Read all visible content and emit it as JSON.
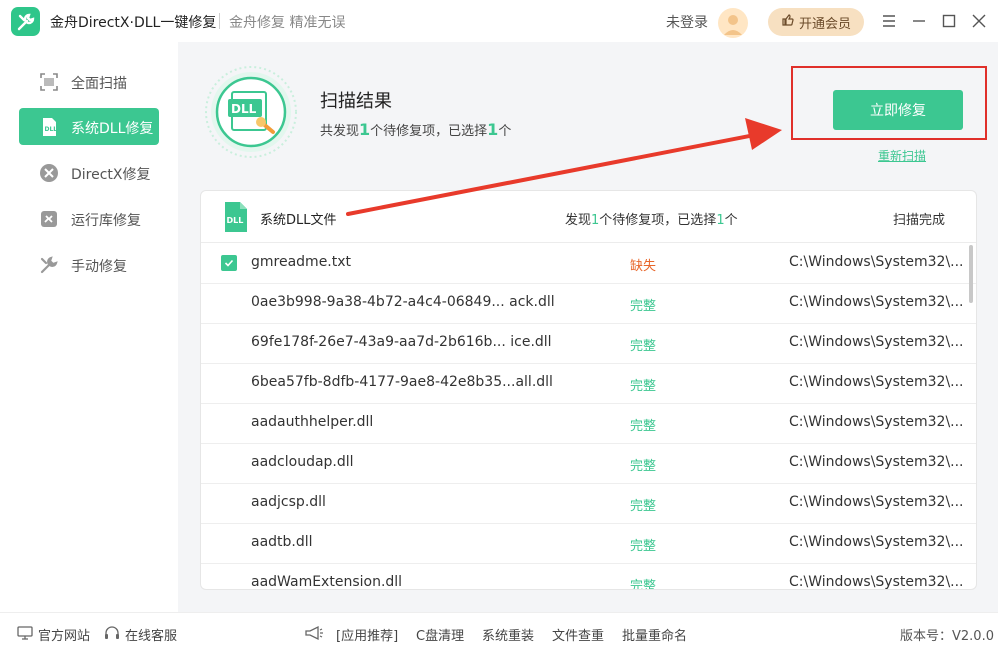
{
  "app": {
    "title": "金舟DirectX·DLL一键修复",
    "slogan": "金舟修复 精准无误",
    "login": "未登录",
    "vip_button": "开通会员"
  },
  "sidebar": {
    "items": [
      {
        "label": "全面扫描",
        "icon": "scan-icon",
        "active": false
      },
      {
        "label": "系统DLL修复",
        "icon": "dll-icon",
        "active": true
      },
      {
        "label": "DirectX修复",
        "icon": "directx-icon",
        "active": false
      },
      {
        "label": "运行库修复",
        "icon": "runtime-icon",
        "active": false
      },
      {
        "label": "手动修复",
        "icon": "wrench-icon",
        "active": false
      }
    ]
  },
  "scan": {
    "title": "扫描结果",
    "sub_prefix": "共发现",
    "found": "1",
    "sub_mid": "个待修复项，已选择",
    "selected": "1",
    "sub_suffix": "个",
    "badge": "DLL"
  },
  "actions": {
    "fix_button": "立即修复",
    "rescan_link": "重新扫描"
  },
  "panel": {
    "icon_text": "DLL",
    "title": "系统DLL文件",
    "count_prefix": "发现",
    "count_found": "1",
    "count_mid": "个待修复项，已选择",
    "count_selected": "1",
    "count_suffix": "个",
    "status": "扫描完成",
    "rows": [
      {
        "name": "gmreadme.txt",
        "status": "缺失",
        "path": "C:\\Windows\\System32\\...",
        "checked": true,
        "missing": true
      },
      {
        "name": "0ae3b998-9a38-4b72-a4c4-06849... ack.dll",
        "status": "完整",
        "path": "C:\\Windows\\System32\\...",
        "checked": false,
        "missing": false
      },
      {
        "name": "69fe178f-26e7-43a9-aa7d-2b616b... ice.dll",
        "status": "完整",
        "path": "C:\\Windows\\System32\\...",
        "checked": false,
        "missing": false
      },
      {
        "name": "6bea57fb-8dfb-4177-9ae8-42e8b35...all.dll",
        "status": "完整",
        "path": "C:\\Windows\\System32\\...",
        "checked": false,
        "missing": false
      },
      {
        "name": "aadauthhelper.dll",
        "status": "完整",
        "path": "C:\\Windows\\System32\\...",
        "checked": false,
        "missing": false
      },
      {
        "name": "aadcloudap.dll",
        "status": "完整",
        "path": "C:\\Windows\\System32\\...",
        "checked": false,
        "missing": false
      },
      {
        "name": "aadjcsp.dll",
        "status": "完整",
        "path": "C:\\Windows\\System32\\...",
        "checked": false,
        "missing": false
      },
      {
        "name": "aadtb.dll",
        "status": "完整",
        "path": "C:\\Windows\\System32\\...",
        "checked": false,
        "missing": false
      },
      {
        "name": "aadWamExtension.dll",
        "status": "完整",
        "path": "C:\\Windows\\System32\\...",
        "checked": false,
        "missing": false
      }
    ]
  },
  "footer": {
    "official_site": "官方网站",
    "online_service": "在线客服",
    "links": [
      "[应用推荐]",
      "C盘清理",
      "系统重装",
      "文件查重",
      "批量重命名"
    ],
    "version": "版本号：V2.0.0"
  },
  "colors": {
    "accent": "#3cc791",
    "missing": "#e8662a",
    "highlight": "#e0302a"
  }
}
